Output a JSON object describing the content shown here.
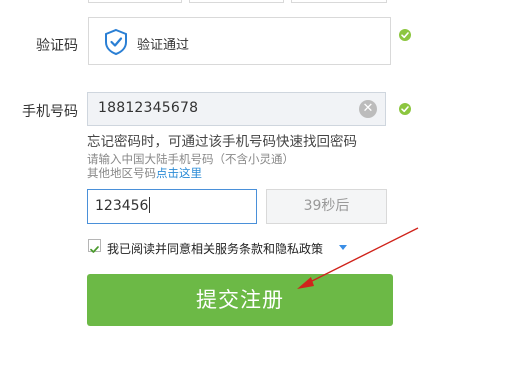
{
  "captcha": {
    "label": "验证码",
    "status_text": "验证通过"
  },
  "phone": {
    "label": "手机号码",
    "value": "18812345678"
  },
  "hints": {
    "main": "忘记密码时，可通过该手机号码快速找回密码",
    "sub": "请输入中国大陆手机号码（不含小灵通）",
    "other_prefix": "其他地区号码",
    "other_link": "点击这里"
  },
  "sms": {
    "code_value": "123456",
    "countdown": "39秒后"
  },
  "agreement": {
    "text": "我已阅读并同意相关服务条款和隐私政策",
    "checked": true
  },
  "submit": {
    "label": "提交注册"
  },
  "colors": {
    "accent_green": "#6cb946",
    "link_blue": "#2a8bd6",
    "annotation_red": "#d0241c",
    "valid_green": "#8cc63f"
  }
}
